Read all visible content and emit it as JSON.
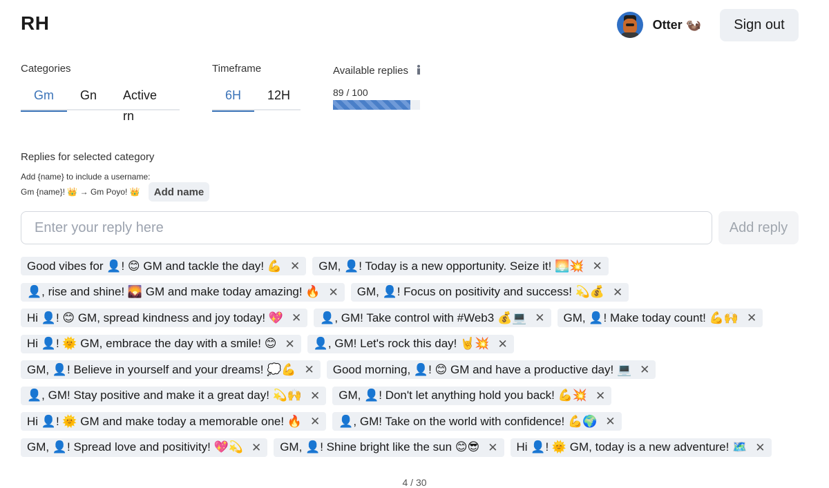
{
  "header": {
    "logo": "RH",
    "username": "Otter 🦦",
    "signout_label": "Sign out"
  },
  "categories": {
    "label": "Categories",
    "tabs": [
      {
        "label": "Gm",
        "active": true
      },
      {
        "label": "Gn",
        "active": false
      },
      {
        "label": "Active rn",
        "active": false
      }
    ]
  },
  "timeframe": {
    "label": "Timeframe",
    "tabs": [
      {
        "label": "6H",
        "active": true
      },
      {
        "label": "12H",
        "active": false
      }
    ]
  },
  "available": {
    "label": "Available replies",
    "text": "89 / 100",
    "used": 89,
    "total": 100,
    "progress_percent": 89
  },
  "replies_section": {
    "label": "Replies for selected category",
    "hint_line1": "Add {name} to include a username:",
    "hint_line2": "Gm {name}! 👑 → Gm Poyo! 👑",
    "add_name_label": "Add name"
  },
  "input": {
    "placeholder": "Enter your reply here",
    "value": "",
    "add_reply_label": "Add reply"
  },
  "chips": [
    [
      "Good vibes for 👤! 😊 GM and tackle the day! 💪",
      "GM, 👤! Today is a new opportunity. Seize it! 🌅💥"
    ],
    [
      "👤, rise and shine! 🌄 GM and make today amazing! 🔥",
      "GM, 👤! Focus on positivity and success! 💫💰"
    ],
    [
      "Hi 👤! 😊 GM, spread kindness and joy today! 💖",
      "👤, GM! Take control with #Web3 💰💻",
      "GM, 👤! Make today count! 💪🙌"
    ],
    [
      "Hi 👤! 🌞 GM, embrace the day with a smile! 😊",
      "👤, GM! Let's rock this day! 🤘💥"
    ],
    [
      "GM, 👤! Believe in yourself and your dreams! 💭💪",
      "Good morning, 👤! 😊 GM and have a productive day! 💻"
    ],
    [
      "👤, GM! Stay positive and make it a great day! 💫🙌",
      "GM, 👤! Don't let anything hold you back! 💪💥"
    ],
    [
      "Hi 👤! 🌞 GM and make today a memorable one! 🔥",
      "👤, GM! Take on the world with confidence! 💪🌍"
    ],
    [
      "GM, 👤! Spread love and positivity! 💖💫",
      "GM, 👤! Shine bright like the sun 😊😎",
      "Hi 👤! 🌞 GM, today is a new adventure! 🗺️"
    ]
  ],
  "pager": {
    "text": "4 / 30"
  }
}
